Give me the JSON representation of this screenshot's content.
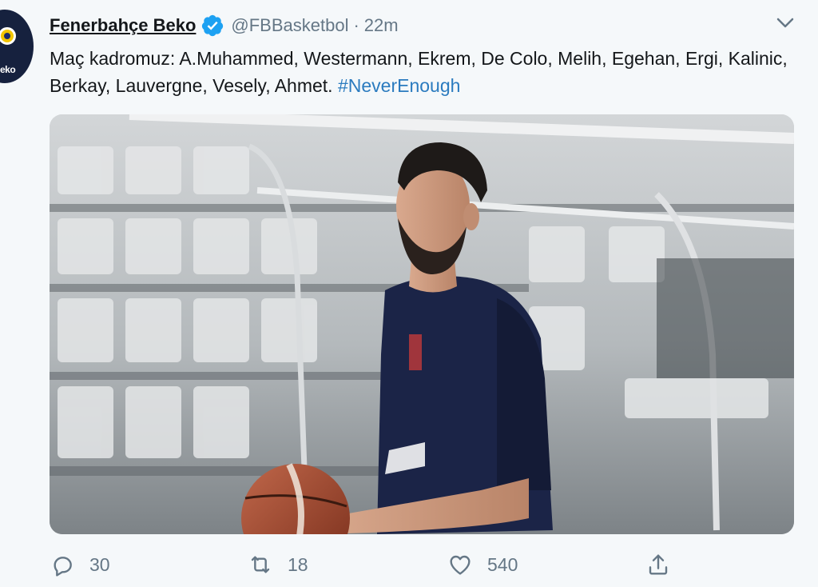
{
  "tweet": {
    "author": {
      "display_name": "Fenerbahçe Beko",
      "handle": "@FBBasketbol",
      "verified": true,
      "avatar_brand": "eko"
    },
    "separator": "·",
    "time": "22m",
    "text": "Maç kadromuz: A.Muhammed, Westermann, Ekrem, De Colo, Melih, Egehan, Ergi, Kalinic, Berkay, Lauvergne, Vesely, Ahmet.",
    "hashtag": "#NeverEnough",
    "actions": {
      "replies": "30",
      "retweets": "18",
      "likes": "540"
    }
  },
  "colors": {
    "background": "#f5f8fa",
    "text": "#14171a",
    "muted": "#657786",
    "link": "#2b7bbf",
    "verified": "#1da1f2",
    "jersey": "#1b2447"
  },
  "icons": {
    "reply": "reply-icon",
    "retweet": "retweet-icon",
    "like": "heart-icon",
    "share": "share-icon",
    "more": "chevron-down-icon",
    "verified": "verified-badge-icon"
  }
}
